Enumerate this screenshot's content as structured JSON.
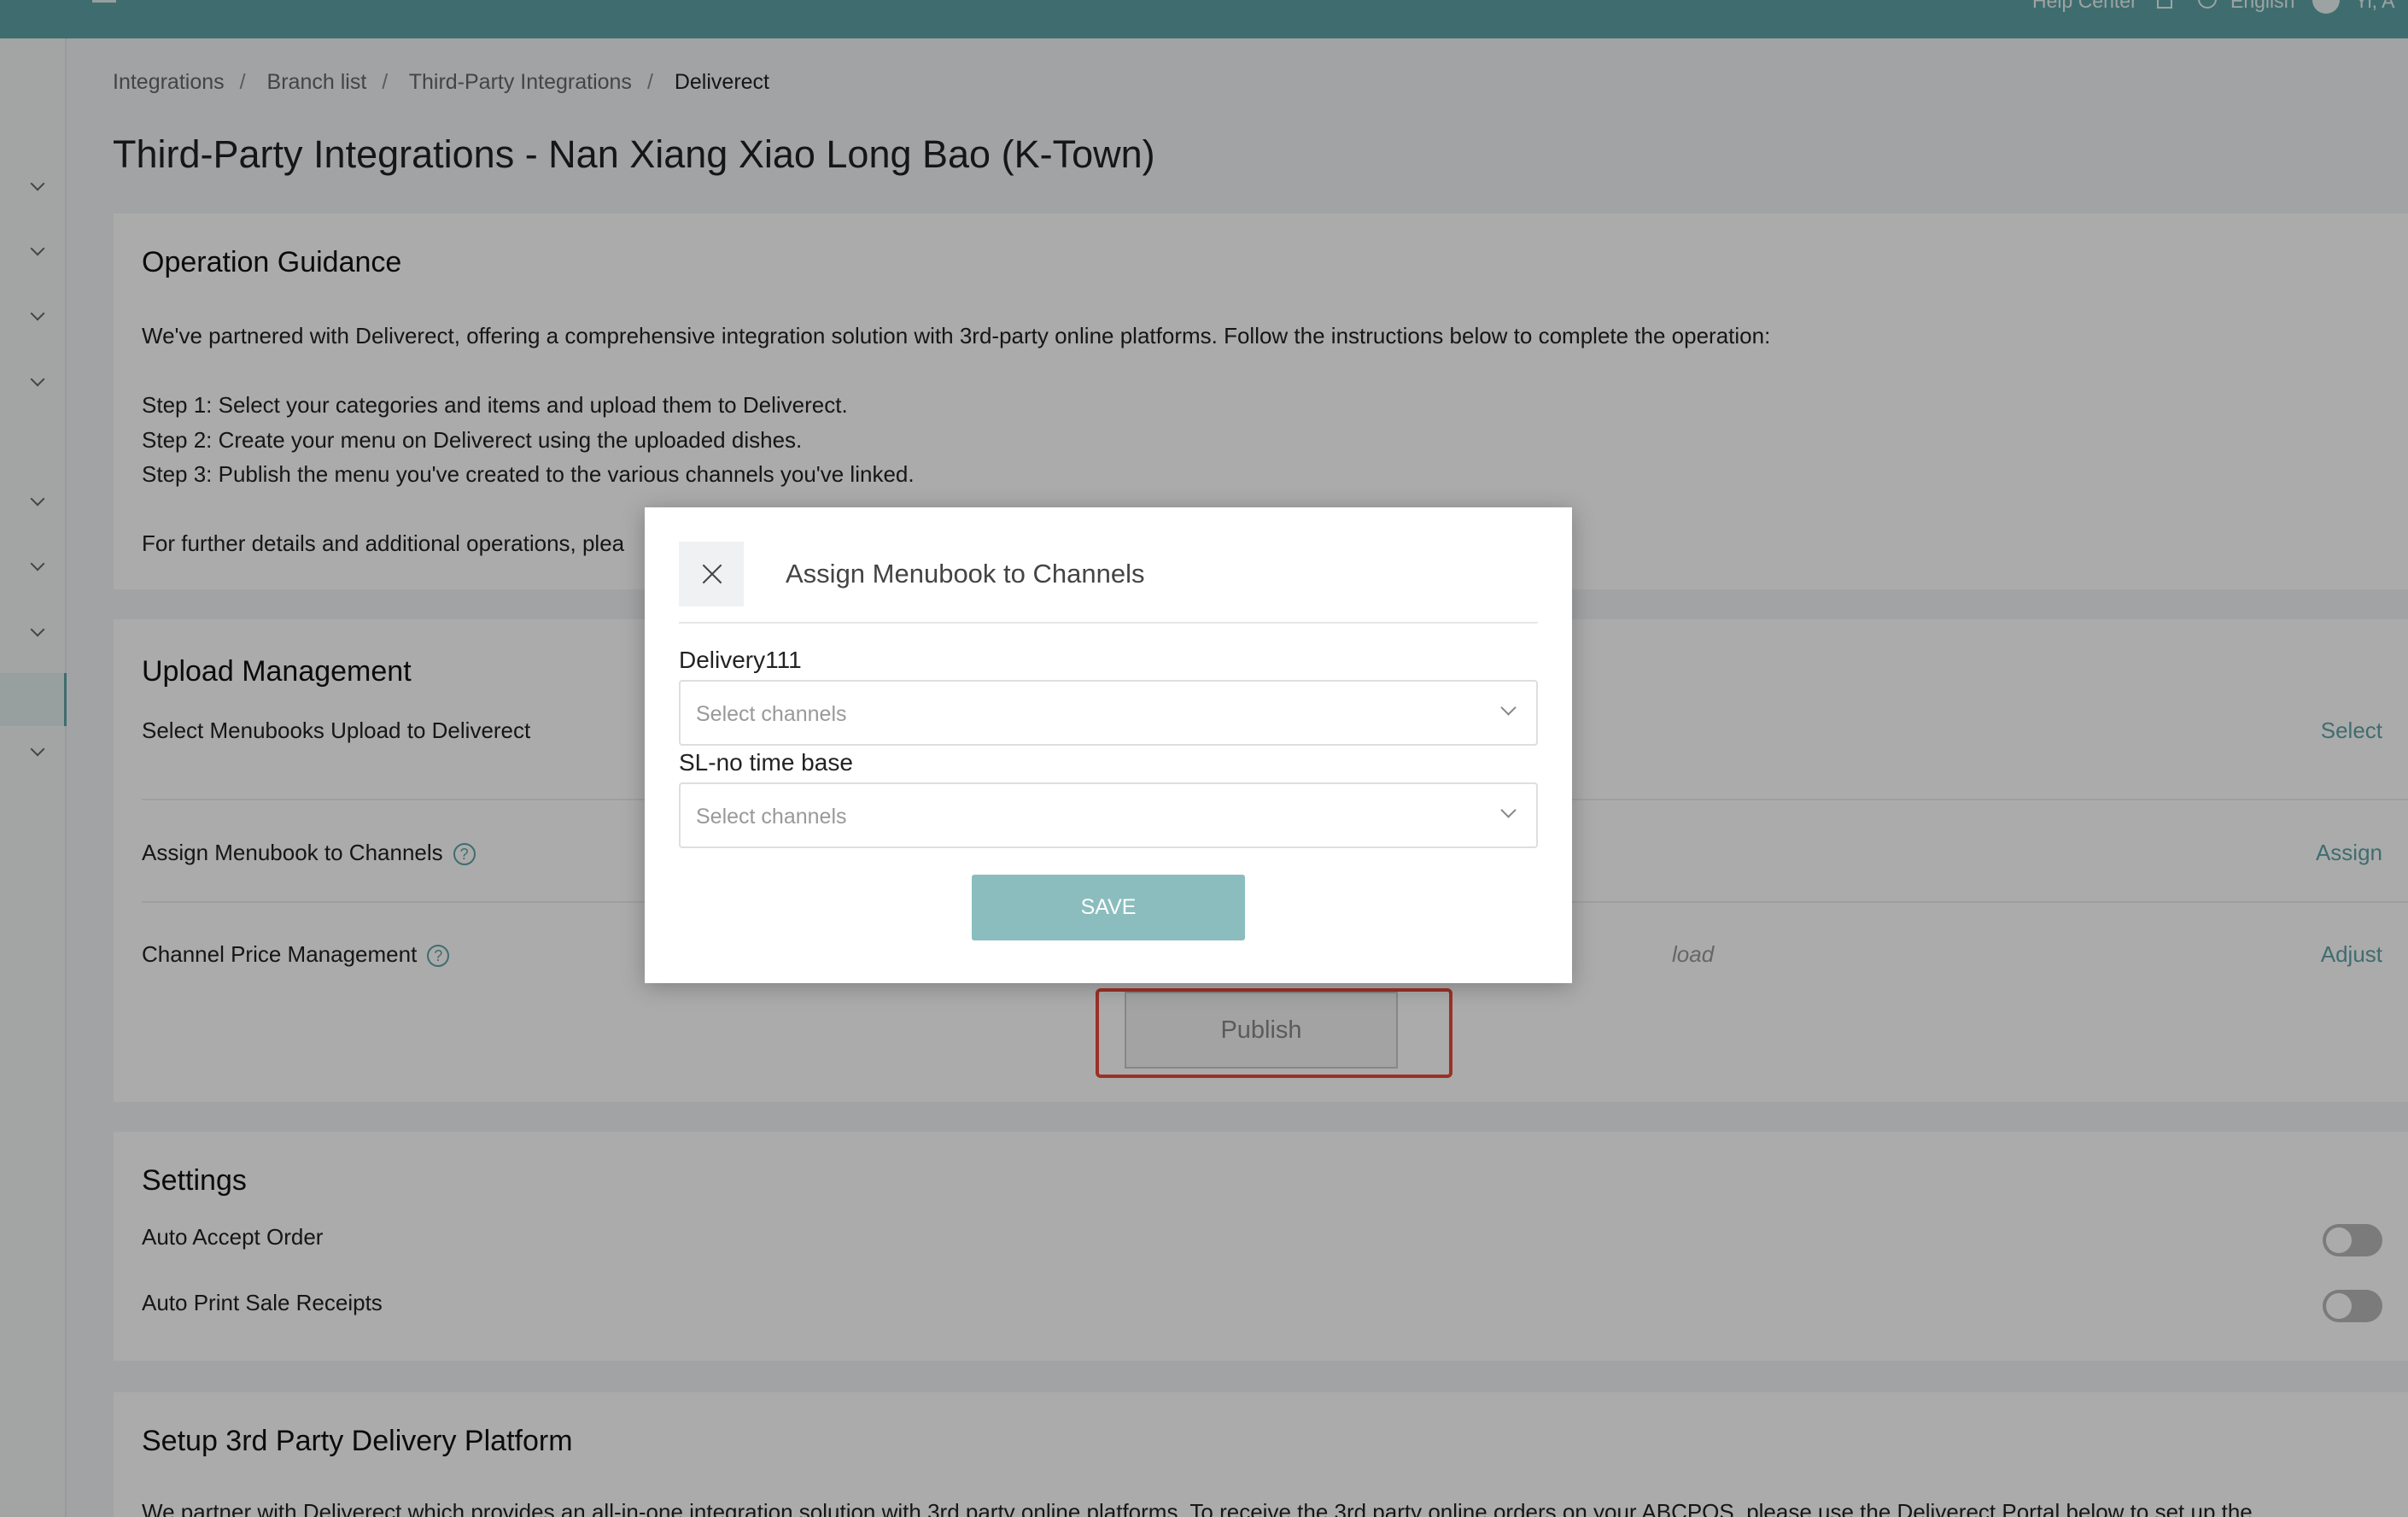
{
  "topbar": {
    "help_label": "Help Center",
    "language": "English",
    "user": "Yi, A"
  },
  "breadcrumb": [
    "Integrations",
    "Branch list",
    "Third-Party Integrations",
    "Deliverect"
  ],
  "page": {
    "title": "Third-Party Integrations - Nan Xiang Xiao Long Bao (K-Town)"
  },
  "guidance": {
    "title": "Operation Guidance",
    "intro": "We've partnered with Deliverect, offering a comprehensive integration solution with 3rd-party online platforms. Follow the instructions below to complete the operation:",
    "steps": [
      "Step 1: Select your categories and items and upload them to Deliverect.",
      "Step 2: Create your menu on Deliverect using the uploaded dishes.",
      "Step 3: Publish the menu you've created to the various channels you've linked."
    ],
    "footer": "For further details and additional operations, plea"
  },
  "upload": {
    "title": "Upload Management",
    "rows": [
      {
        "label": "Select Menubooks Upload to Deliverect",
        "action": "Select"
      },
      {
        "label": "Assign Menubook to Channels",
        "action": "Assign"
      },
      {
        "label": "Channel Price Management",
        "action": "Adjust"
      }
    ],
    "price_hint": "load",
    "publish_label": "Publish"
  },
  "settings": {
    "title": "Settings",
    "items": [
      {
        "label": "Auto Accept Order",
        "enabled": false
      },
      {
        "label": "Auto Print Sale Receipts",
        "enabled": false
      }
    ]
  },
  "setup": {
    "title": "Setup 3rd Party Delivery Platform",
    "text": "We partner with Deliverect which provides an all-in-one integration solution with 3rd party online platforms. To receive the 3rd party online orders on your ABCPOS, please use the Deliverect Portal below to set up the"
  },
  "modal": {
    "title": "Assign Menubook to Channels",
    "fields": [
      {
        "label": "Delivery111",
        "placeholder": "Select channels"
      },
      {
        "label": "SL-no time base",
        "placeholder": "Select channels"
      }
    ],
    "save_label": "SAVE"
  },
  "colors": {
    "accent": "#5fa3a6",
    "highlight": "#e8493a",
    "save": "#8bbdbe"
  }
}
